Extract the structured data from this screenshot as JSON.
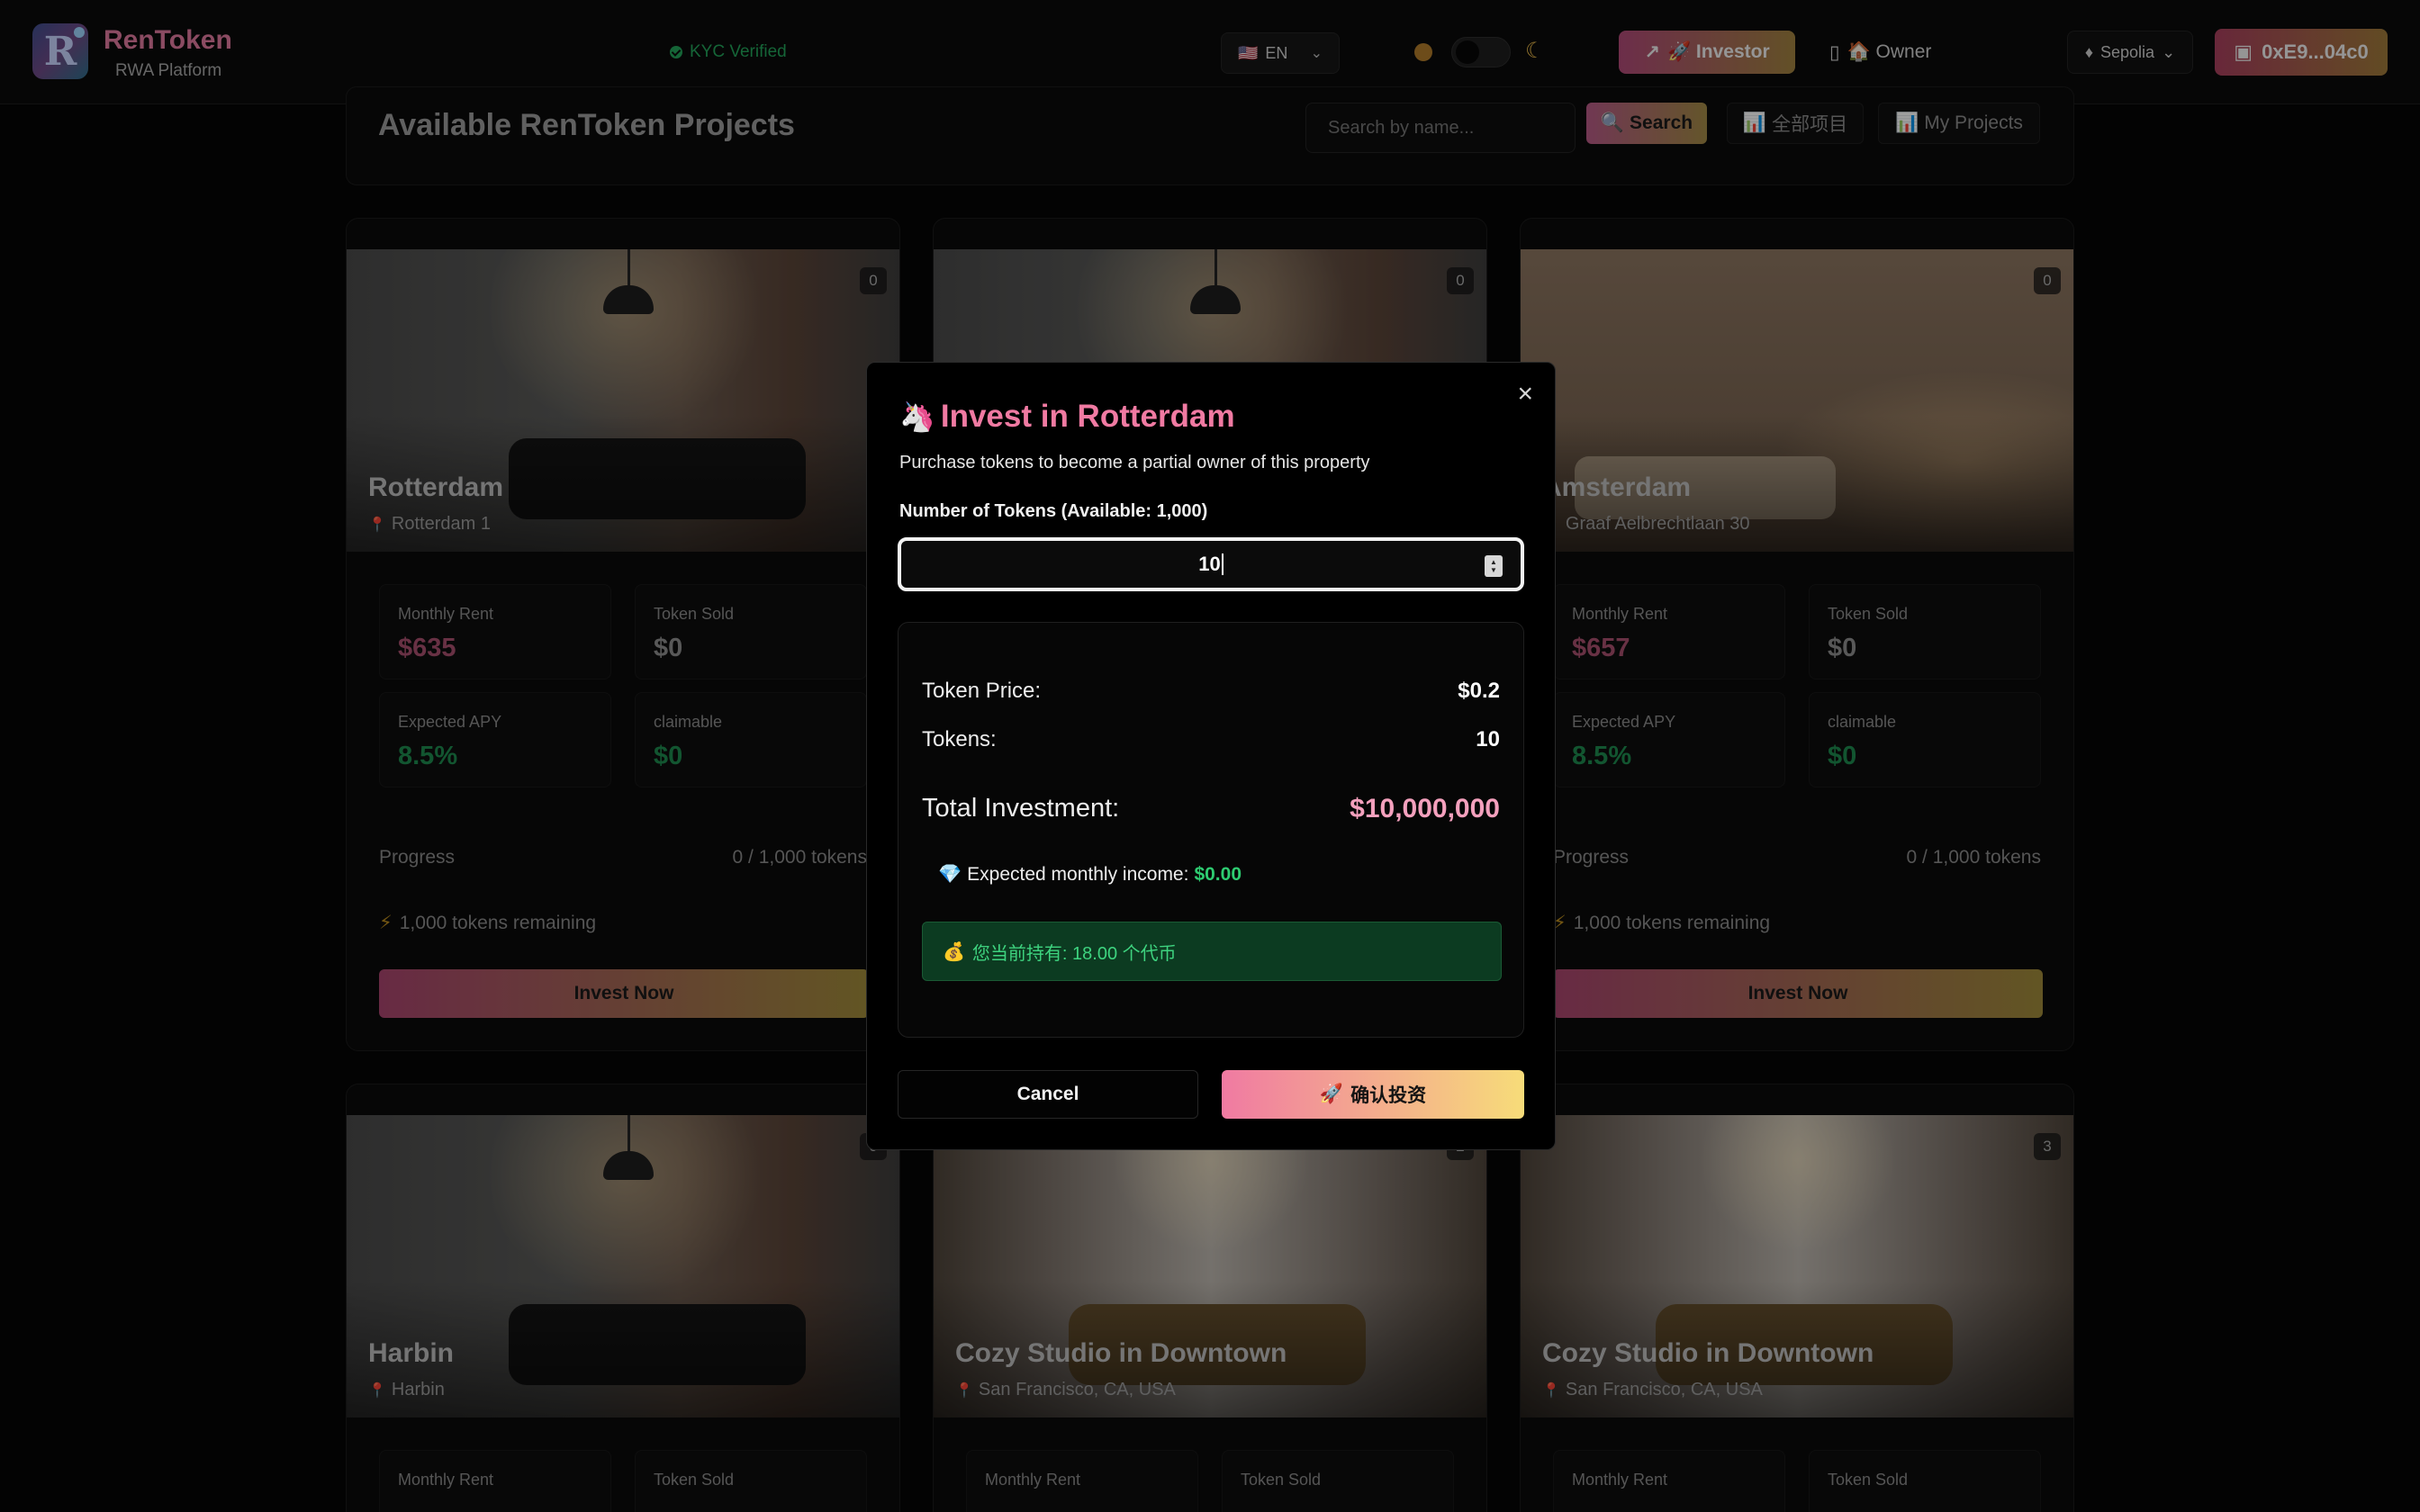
{
  "header": {
    "logo_letter": "R",
    "brand_name": "RenToken",
    "brand_sub": "RWA Platform",
    "kyc": "KYC Verified",
    "language": {
      "flag": "🇺🇸",
      "label": "EN"
    },
    "role_investor": "🚀 Investor",
    "role_owner": "🏠 Owner",
    "network": "Sepolia",
    "wallet": "0xE9...04c0"
  },
  "page": {
    "title": "Available RenToken Projects",
    "search_placeholder": "Search by name...",
    "search_button": "Search",
    "all_projects": "全部项目",
    "my_projects": "My Projects"
  },
  "cards": [
    {
      "title": "Rotterdam",
      "location": "Rotterdam 1",
      "badge": "0",
      "image": "loft",
      "stats": {
        "monthly_rent_label": "Monthly Rent",
        "monthly_rent": "$635",
        "token_sold_label": "Token Sold",
        "token_sold": "$0",
        "apy_label": "Expected APY",
        "apy": "8.5%",
        "claimable_label": "claimable",
        "claimable": "$0"
      },
      "progress_label": "Progress",
      "progress_value": "0 / 1,000 tokens",
      "progress_pct": 0,
      "remaining": "1,000 tokens remaining",
      "invest_button": "Invest Now"
    },
    {
      "title": "",
      "location": "",
      "badge": "0",
      "image": "loft"
    },
    {
      "title": "Amsterdam",
      "location": "Graaf Aelbrechtlaan 30",
      "badge": "0",
      "image": "cream",
      "stats": {
        "monthly_rent_label": "Monthly Rent",
        "monthly_rent": "$657",
        "token_sold_label": "Token Sold",
        "token_sold": "$0",
        "apy_label": "Expected APY",
        "apy": "8.5%",
        "claimable_label": "claimable",
        "claimable": "$0"
      },
      "progress_label": "Progress",
      "progress_value": "0 / 1,000 tokens",
      "progress_pct": 0,
      "remaining": "1,000 tokens remaining",
      "invest_button": "Invest Now"
    },
    {
      "title": "Harbin",
      "location": "Harbin",
      "badge": "0",
      "image": "loft",
      "stats": {
        "monthly_rent_label": "Monthly Rent",
        "token_sold_label": "Token Sold"
      }
    },
    {
      "title": "Cozy Studio in Downtown",
      "location": "San Francisco, CA, USA",
      "badge": "2",
      "image": "marble",
      "stats": {
        "monthly_rent_label": "Monthly Rent",
        "token_sold_label": "Token Sold"
      }
    },
    {
      "title": "Cozy Studio in Downtown",
      "location": "San Francisco, CA, USA",
      "badge": "3",
      "image": "marble",
      "stats": {
        "monthly_rent_label": "Monthly Rent",
        "token_sold_label": "Token Sold"
      }
    }
  ],
  "modal": {
    "title": "Invest in Rotterdam",
    "subtitle": "Purchase tokens to become a partial owner of this property",
    "qty_label": "Number of Tokens (Available: 1,000)",
    "qty_value": "10",
    "token_price_label": "Token Price:",
    "token_price": "$0.2",
    "tokens_label": "Tokens:",
    "tokens": "10",
    "total_label": "Total Investment:",
    "total": "$10,000,000",
    "income_label": "Expected monthly income:",
    "income_value": "$0.00",
    "holding": "您当前持有: 18.00 个代币",
    "cancel": "Cancel",
    "confirm": "确认投资"
  },
  "colors": {
    "accent_pink": "#f07aa2",
    "accent_gold": "#f7dc79",
    "success_green": "#2ecc71",
    "background": "#050505"
  },
  "icons": [
    "logo-icon",
    "check-icon",
    "flag-us-icon",
    "chevron-down-icon",
    "sun-icon",
    "moon-icon",
    "trend-icon",
    "rocket-icon",
    "building-icon",
    "house-icon",
    "ethereum-icon",
    "wallet-icon",
    "search-icon",
    "chart-icon",
    "pin-icon",
    "bolt-icon",
    "unicorn-icon",
    "close-icon",
    "gem-icon",
    "money-bag-icon"
  ]
}
